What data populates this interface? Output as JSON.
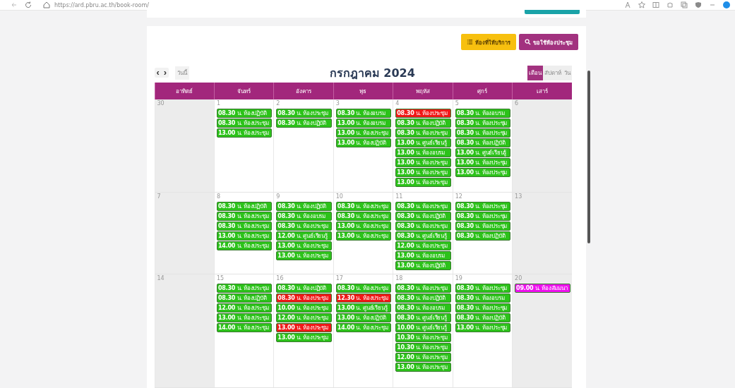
{
  "browser": {
    "url": "https://ard.pbru.ac.th/book-room/"
  },
  "actions": [
    {
      "kind": "list",
      "label": "ห้องที่ให้บริการ"
    },
    {
      "kind": "search",
      "label": "ขอใช้ห้องประชุม"
    }
  ],
  "toolbar": {
    "prev": "‹",
    "next": "›",
    "today": "วันนี้",
    "title": "กรกฎาคม 2024",
    "views": [
      {
        "label": "เดือน",
        "selected": true
      },
      {
        "label": "สัปดาห์",
        "selected": false
      },
      {
        "label": "วัน",
        "selected": false
      }
    ]
  },
  "weekdays": [
    "อาทิตย์",
    "จันทร์",
    "อังคาร",
    "พุธ",
    "พฤหัส",
    "ศุกร์",
    "เสาร์"
  ],
  "weeks": [
    {
      "days": [
        {
          "date": "30",
          "weekend": true
        },
        {
          "date": "1",
          "weekend": false,
          "events": [
            {
              "text": "**08.30** น. ห้องปฏิบัติ",
              "color": "#2cc21a"
            },
            {
              "text": "**08.30** น. ห้องประชุม",
              "color": "#2cc21a"
            },
            {
              "text": "**13.00** น. ห้องประชุม",
              "color": "#2cc21a"
            }
          ]
        },
        {
          "date": "2",
          "weekend": false,
          "events": [
            {
              "text": "**08.30** น. ห้องประชุม",
              "color": "#2cc21a"
            },
            {
              "text": "**08.30** น. ห้องปฏิบัติ",
              "color": "#2cc21a"
            }
          ]
        },
        {
          "date": "3",
          "weekend": false,
          "events": [
            {
              "text": "**08.30** น. ห้องอบรม",
              "color": "#2cc21a"
            },
            {
              "text": "**13.00** น. ห้องอบรม",
              "color": "#2cc21a"
            },
            {
              "text": "**13.00** น. ห้องประชุม",
              "color": "#2cc21a"
            },
            {
              "text": "**13.00** น. ห้องปฏิบัติ",
              "color": "#2cc21a"
            }
          ]
        },
        {
          "date": "4",
          "weekend": false,
          "events": [
            {
              "text": "**08.30** น. ห้องประชุม",
              "color": "#f01818"
            },
            {
              "text": "**08.30** น. ห้องปฏิบัติ",
              "color": "#2cc21a"
            },
            {
              "text": "**08.30** น. ห้องประชุม",
              "color": "#2cc21a"
            },
            {
              "text": "**13.00** น. ศูนย์เรียนรู้",
              "color": "#2cc21a"
            },
            {
              "text": "**13.00** น. ห้องอบรม",
              "color": "#2cc21a"
            },
            {
              "text": "**13.00** น. ห้องประชุม",
              "color": "#2cc21a"
            },
            {
              "text": "**13.00** น. ห้องประชุม",
              "color": "#2cc21a"
            },
            {
              "text": "**13.00** น. ห้องประชุม",
              "color": "#2cc21a"
            }
          ]
        },
        {
          "date": "5",
          "weekend": false,
          "events": [
            {
              "text": "**08.30** น. ห้องอบรม",
              "color": "#2cc21a"
            },
            {
              "text": "**08.30** น. ห้องประชุม",
              "color": "#2cc21a"
            },
            {
              "text": "**08.30** น. ห้องประชุม",
              "color": "#2cc21a"
            },
            {
              "text": "**08.30** น. ห้องปฏิบัติ",
              "color": "#2cc21a"
            },
            {
              "text": "**13.00** น. ศูนย์เรียนรู้",
              "color": "#2cc21a"
            },
            {
              "text": "**13.00** น. ห้องประชุม",
              "color": "#2cc21a"
            },
            {
              "text": "**13.00** น. ห้องประชุม",
              "color": "#2cc21a"
            }
          ]
        },
        {
          "date": "6",
          "weekend": true
        }
      ]
    },
    {
      "days": [
        {
          "date": "7",
          "weekend": true
        },
        {
          "date": "8",
          "weekend": false,
          "events": [
            {
              "text": "**08.30** น. ห้องปฏิบัติ",
              "color": "#2cc21a"
            },
            {
              "text": "**08.30** น. ห้องประชุม",
              "color": "#2cc21a"
            },
            {
              "text": "**08.30** น. ห้องประชุม",
              "color": "#2cc21a"
            },
            {
              "text": "**13.00** น. ห้องประชุม",
              "color": "#2cc21a"
            },
            {
              "text": "**14.00** น. ห้องประชุม",
              "color": "#2cc21a"
            }
          ]
        },
        {
          "date": "9",
          "weekend": false,
          "events": [
            {
              "text": "**08.30** น. ห้องปฏิบัติ",
              "color": "#2cc21a"
            },
            {
              "text": "**08.30** น. ห้องอบรม",
              "color": "#2cc21a"
            },
            {
              "text": "**08.30** น. ห้องประชุม",
              "color": "#2cc21a"
            },
            {
              "text": "**12.00** น. ศูนย์เรียนรู้",
              "color": "#2cc21a"
            },
            {
              "text": "**13.00** น. ห้องประชุม",
              "color": "#2cc21a"
            },
            {
              "text": "**13.00** น. ห้องประชุม",
              "color": "#2cc21a"
            }
          ]
        },
        {
          "date": "10",
          "weekend": false,
          "events": [
            {
              "text": "**08.30** น. ห้องประชุม",
              "color": "#2cc21a"
            },
            {
              "text": "**08.30** น. ห้องประชุม",
              "color": "#2cc21a"
            },
            {
              "text": "**13.00** น. ห้องประชุม",
              "color": "#2cc21a"
            },
            {
              "text": "**13.00** น. ห้องประชุม",
              "color": "#2cc21a"
            }
          ]
        },
        {
          "date": "11",
          "weekend": false,
          "events": [
            {
              "text": "**08.30** น. ห้องประชุม",
              "color": "#2cc21a"
            },
            {
              "text": "**08.30** น. ห้องปฏิบัติ",
              "color": "#2cc21a"
            },
            {
              "text": "**08.30** น. ห้องประชุม",
              "color": "#2cc21a"
            },
            {
              "text": "**08.30** น. ศูนย์เรียนรู้",
              "color": "#2cc21a"
            },
            {
              "text": "**12.00** น. ห้องประชุม",
              "color": "#2cc21a"
            },
            {
              "text": "**13.00** น. ห้องอบรม",
              "color": "#2cc21a"
            },
            {
              "text": "**13.00** น. ห้องปฏิบัติ",
              "color": "#2cc21a"
            }
          ]
        },
        {
          "date": "12",
          "weekend": false,
          "events": [
            {
              "text": "**08.30** น. ห้องประชุม",
              "color": "#2cc21a"
            },
            {
              "text": "**08.30** น. ห้องประชุม",
              "color": "#2cc21a"
            },
            {
              "text": "**08.30** น. ห้องประชุม",
              "color": "#2cc21a"
            },
            {
              "text": "**08.30** น. ห้องปฏิบัติ",
              "color": "#2cc21a"
            }
          ]
        },
        {
          "date": "13",
          "weekend": true
        }
      ]
    },
    {
      "days": [
        {
          "date": "14",
          "weekend": true
        },
        {
          "date": "15",
          "weekend": false,
          "events": [
            {
              "text": "**08.30** น. ห้องประชุม",
              "color": "#2cc21a"
            },
            {
              "text": "**08.30** น. ห้องปฏิบัติ",
              "color": "#2cc21a"
            },
            {
              "text": "**12.00** น. ห้องประชุม",
              "color": "#2cc21a"
            },
            {
              "text": "**13.00** น. ห้องประชุม",
              "color": "#2cc21a"
            },
            {
              "text": "**14.00** น. ห้องประชุม",
              "color": "#2cc21a"
            }
          ]
        },
        {
          "date": "16",
          "weekend": false,
          "events": [
            {
              "text": "**08.30** น. ห้องปฏิบัติ",
              "color": "#2cc21a"
            },
            {
              "text": "**08.30** น. ห้องประชุม",
              "color": "#f01818"
            },
            {
              "text": "**10.00** น. ห้องประชุม",
              "color": "#2cc21a"
            },
            {
              "text": "**12.00** น. ห้องประชุม",
              "color": "#2cc21a"
            },
            {
              "text": "**13.00** น. ห้องประชุม",
              "color": "#f01818"
            },
            {
              "text": "**13.00** น. ห้องประชุม",
              "color": "#2cc21a"
            }
          ]
        },
        {
          "date": "17",
          "weekend": false,
          "events": [
            {
              "text": "**08.30** น. ห้องประชุม",
              "color": "#2cc21a"
            },
            {
              "text": "**12.30** น. ห้องประชุม",
              "color": "#f01818"
            },
            {
              "text": "**13.00** น. ศูนย์เรียนรู้",
              "color": "#2cc21a"
            },
            {
              "text": "**13.00** น. ห้องปฏิบัติ",
              "color": "#2cc21a"
            },
            {
              "text": "**14.00** น. ห้องประชุม",
              "color": "#2cc21a"
            }
          ]
        },
        {
          "date": "18",
          "weekend": false,
          "events": [
            {
              "text": "**08.30** น. ห้องประชุม",
              "color": "#2cc21a"
            },
            {
              "text": "**08.30** น. ห้องปฏิบัติ",
              "color": "#2cc21a"
            },
            {
              "text": "**08.30** น. ห้องอบรม",
              "color": "#2cc21a"
            },
            {
              "text": "**08.30** น. ศูนย์เรียนรู้",
              "color": "#2cc21a"
            },
            {
              "text": "**10.00** น. ศูนย์เรียนรู้",
              "color": "#2cc21a"
            },
            {
              "text": "**10.30** น. ห้องประชุม",
              "color": "#2cc21a"
            },
            {
              "text": "**10.30** น. ห้องประชุม",
              "color": "#2cc21a"
            },
            {
              "text": "**12.00** น. ห้องประชุม",
              "color": "#2cc21a"
            },
            {
              "text": "**13.00** น. ห้องประชุม",
              "color": "#2cc21a"
            }
          ]
        },
        {
          "date": "19",
          "weekend": false,
          "events": [
            {
              "text": "**08.30** น. ห้องประชุม",
              "color": "#2cc21a"
            },
            {
              "text": "**08.30** น. ห้องอบรม",
              "color": "#2cc21a"
            },
            {
              "text": "**08.30** น. ห้องประชุม",
              "color": "#2cc21a"
            },
            {
              "text": "**08.30** น. ห้องปฏิบัติ",
              "color": "#2cc21a"
            },
            {
              "text": "**13.00** น. ห้องประชุม",
              "color": "#2cc21a"
            }
          ]
        },
        {
          "date": "20",
          "weekend": true,
          "events": [
            {
              "text": "**09.00** น. ห้องสัมมนา",
              "color": "#ee11ee"
            }
          ]
        }
      ]
    }
  ]
}
